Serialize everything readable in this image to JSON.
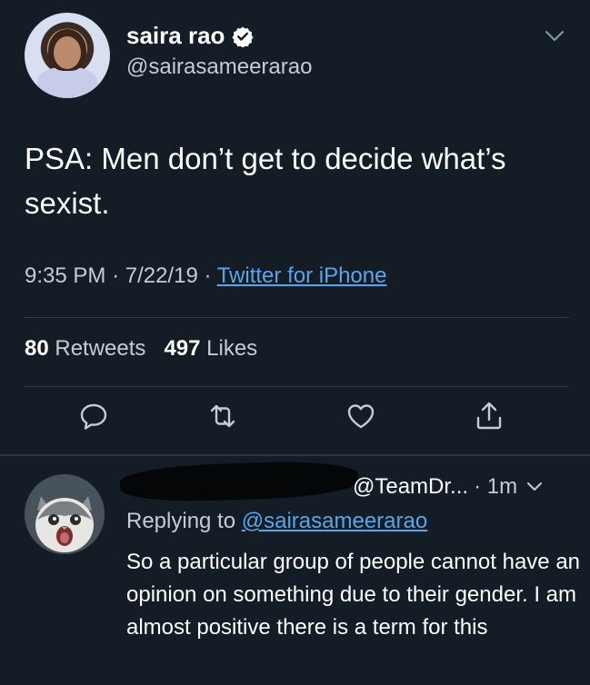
{
  "tweet": {
    "display_name": "saira rao",
    "handle": "@sairasameerarao",
    "text": "PSA: Men don’t get to decide what’s sexist.",
    "time": "9:35 PM",
    "date": "7/22/19",
    "separator": "·",
    "source": "Twitter for iPhone",
    "retweets_count": "80",
    "retweets_label": "Retweets",
    "likes_count": "497",
    "likes_label": "Likes"
  },
  "reply": {
    "handle": "@TeamDr...",
    "time": "· 1m",
    "replying_prefix": "Replying to",
    "replying_mention": "@sairasameerarao",
    "text": "So a particular group of people cannot have an opinion on something due to their gender. I am almost positive there is a term for this"
  },
  "colors": {
    "background": "#141d26",
    "link": "#58a6e8",
    "secondary_text": "#c4ccd4"
  },
  "icons": [
    "verified-badge-icon",
    "chevron-down-icon",
    "reply-icon",
    "retweet-icon",
    "like-icon",
    "share-icon"
  ]
}
